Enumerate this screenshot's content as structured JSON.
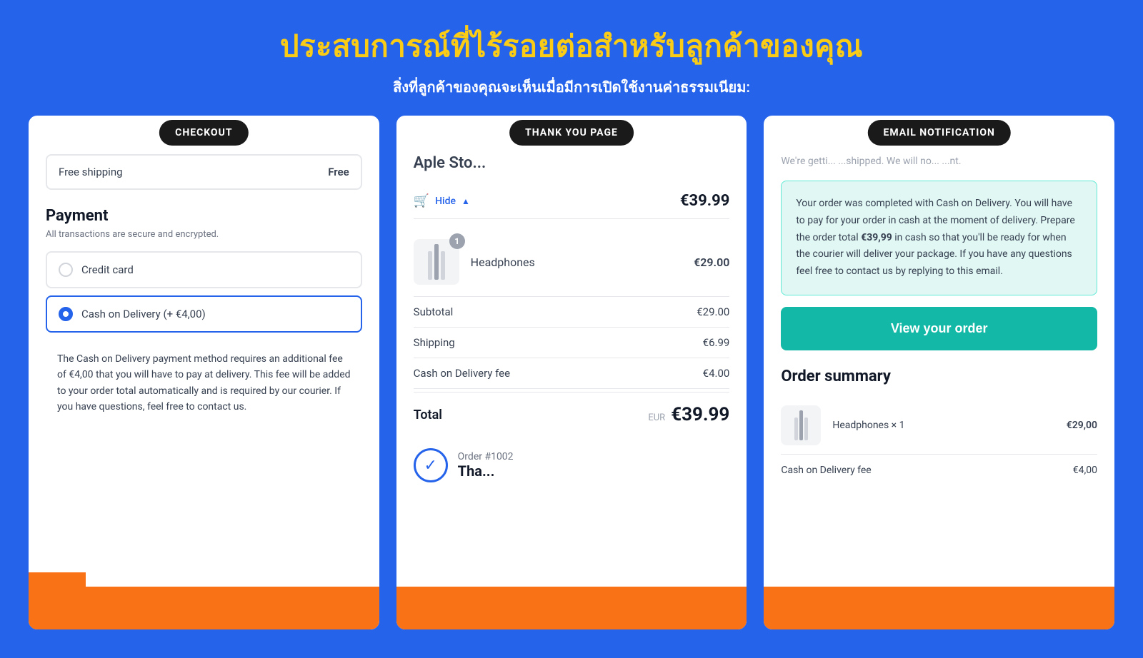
{
  "header": {
    "title": "ประสบการณ์ที่ไร้รอยต่อสำหรับลูกค้าของคุณ",
    "subtitle": "สิ่งที่ลูกค้าของคุณจะเห็นเมื่อมีการเปิดใช้งานค่าธรรมเนียม:"
  },
  "badges": {
    "checkout": "CHECKOUT",
    "thankYou": "THANK YOU PAGE",
    "emailNotif": "EMAIL NOTIFICATION"
  },
  "card1": {
    "freeShipping": {
      "label": "Free shipping",
      "value": "Free"
    },
    "payment": {
      "title": "Payment",
      "subtitle": "All transactions are secure and encrypted.",
      "options": [
        {
          "label": "Credit card",
          "selected": false
        },
        {
          "label": "Cash on Delivery (+ €4,00)",
          "selected": true
        }
      ],
      "codNote": "The Cash on Delivery payment method requires an additional fee of €4,00 that you will have to pay at delivery. This fee will be added to your order total automatically and is required by our courier. If you have questions, feel free to contact us."
    }
  },
  "card2": {
    "storeName": "Aple Sto...",
    "cartTotal": "€39.99",
    "hideLabel": "Hide",
    "product": {
      "name": "Headphones",
      "price": "€29.00",
      "qty": "1"
    },
    "subtotal": {
      "label": "Subtotal",
      "value": "€29.00"
    },
    "shipping": {
      "label": "Shipping",
      "value": "€6.99"
    },
    "codFee": {
      "label": "Cash on Delivery fee",
      "value": "€4.00"
    },
    "total": {
      "label": "Total",
      "currency": "EUR",
      "value": "€39.99"
    },
    "orderNumber": "Order #1002",
    "orderConfirmText": "Tha..."
  },
  "card3": {
    "headerText": "We're getti... ...shipped. We will no... ...nt.",
    "emailBody": "Your order was completed with Cash on Delivery. You will have to pay for your order in cash at the moment of delivery. Prepare the order total €39,99 in cash so that you'll be ready for when the courier will deliver your package. If you have any questions feel free to contact us by replying to this email.",
    "emailBodyHighlight": "€39,99",
    "viewOrderBtn": "View your order",
    "orderSummaryTitle": "Order summary",
    "product": {
      "name": "Headphones × 1",
      "price": "€29,00"
    },
    "codFee": {
      "label": "Cash on Delivery fee",
      "value": "€4,00"
    }
  }
}
